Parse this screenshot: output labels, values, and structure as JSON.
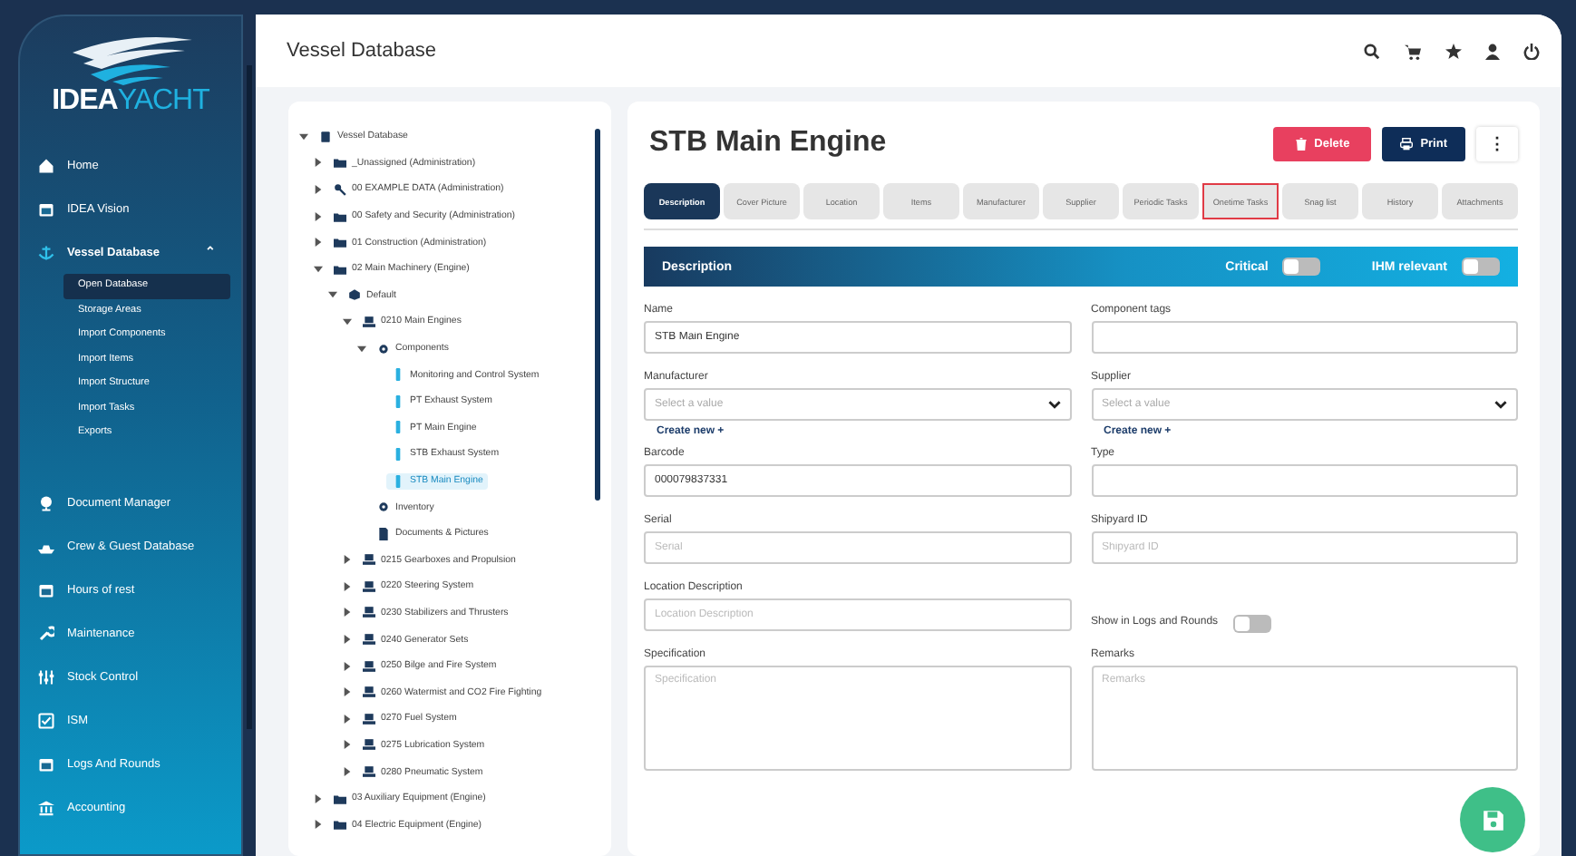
{
  "brand": {
    "part_1": "IDEA",
    "part_2": "YACHT"
  },
  "sidebar": {
    "items": [
      {
        "label": "Home",
        "kind": "home",
        "selected": false
      },
      {
        "label": "IDEA Vision",
        "kind": "calendar",
        "selected": false
      },
      {
        "label": "Vessel Database",
        "kind": "anchor",
        "selected": true,
        "expanded": true,
        "caret": "⌃",
        "children": [
          {
            "label": "Open Database",
            "selected": true
          },
          {
            "label": "Storage Areas",
            "selected": false
          },
          {
            "label": "Import Components",
            "selected": false
          },
          {
            "label": "Import Items",
            "selected": false
          },
          {
            "label": "Import Structure",
            "selected": false
          },
          {
            "label": "Import Tasks",
            "selected": false
          },
          {
            "label": "Exports",
            "selected": false
          }
        ]
      },
      {
        "label": "Document Manager",
        "kind": "globe",
        "selected": false
      },
      {
        "label": "Crew & Guest Database",
        "kind": "ship",
        "selected": false
      },
      {
        "label": "Hours of rest",
        "kind": "calendar",
        "selected": false
      },
      {
        "label": "Maintenance",
        "kind": "wrench",
        "selected": false
      },
      {
        "label": "Stock Control",
        "kind": "sliders",
        "selected": false
      },
      {
        "label": "ISM",
        "kind": "check",
        "selected": false
      },
      {
        "label": "Logs And Rounds",
        "kind": "calendar",
        "selected": false
      },
      {
        "label": "Accounting",
        "kind": "bank",
        "selected": false
      }
    ]
  },
  "topbar": {
    "title": "Vessel Database"
  },
  "tree": [
    {
      "label": "Vessel Database",
      "kind": "db",
      "expanded": true,
      "selected": false,
      "children": [
        {
          "label": "_Unassigned (Administration)",
          "kind": "folder",
          "expanded": false,
          "selected": false
        },
        {
          "label": "00 EXAMPLE DATA (Administration)",
          "kind": "key",
          "expanded": false,
          "selected": false
        },
        {
          "label": "00 Safety and Security (Administration)",
          "kind": "folder",
          "expanded": false,
          "selected": false
        },
        {
          "label": "01 Construction (Administration)",
          "kind": "folder",
          "expanded": false,
          "selected": false
        },
        {
          "label": "02 Main Machinery (Engine)",
          "kind": "folder",
          "expanded": true,
          "selected": false,
          "children": [
            {
              "label": "Default",
              "kind": "box",
              "expanded": true,
              "selected": false,
              "children": [
                {
                  "label": "0210 Main Engines",
                  "kind": "machine",
                  "expanded": true,
                  "selected": false,
                  "children": [
                    {
                      "label": "Components",
                      "kind": "cog",
                      "expanded": true,
                      "selected": false,
                      "children": [
                        {
                          "label": "Monitoring and Control System",
                          "kind": "part",
                          "selected": false
                        },
                        {
                          "label": "PT Exhaust System",
                          "kind": "part",
                          "selected": false
                        },
                        {
                          "label": "PT Main Engine",
                          "kind": "part",
                          "selected": false
                        },
                        {
                          "label": "STB Exhaust System",
                          "kind": "part",
                          "selected": false
                        },
                        {
                          "label": "STB Main Engine",
                          "kind": "part",
                          "selected": true
                        }
                      ]
                    },
                    {
                      "label": "Inventory",
                      "kind": "cog",
                      "selected": false
                    },
                    {
                      "label": "Documents & Pictures",
                      "kind": "doc",
                      "selected": false
                    }
                  ]
                },
                {
                  "label": "0215 Gearboxes and Propulsion",
                  "kind": "machine",
                  "expanded": false,
                  "selected": false
                },
                {
                  "label": "0220 Steering System",
                  "kind": "machine",
                  "expanded": false,
                  "selected": false
                },
                {
                  "label": "0230 Stabilizers and Thrusters",
                  "kind": "machine",
                  "expanded": false,
                  "selected": false
                },
                {
                  "label": "0240 Generator Sets",
                  "kind": "machine",
                  "expanded": false,
                  "selected": false
                },
                {
                  "label": "0250 Bilge and Fire System",
                  "kind": "machine",
                  "expanded": false,
                  "selected": false
                },
                {
                  "label": "0260 Watermist and CO2 Fire Fighting",
                  "kind": "machine",
                  "expanded": false,
                  "selected": false
                },
                {
                  "label": "0270 Fuel System",
                  "kind": "machine",
                  "expanded": false,
                  "selected": false
                },
                {
                  "label": "0275 Lubrication System",
                  "kind": "machine",
                  "expanded": false,
                  "selected": false
                },
                {
                  "label": "0280 Pneumatic System",
                  "kind": "machine",
                  "expanded": false,
                  "selected": false
                }
              ]
            }
          ]
        },
        {
          "label": "03 Auxiliary Equipment (Engine)",
          "kind": "folder",
          "expanded": false,
          "selected": false
        },
        {
          "label": "04 Electric Equipment (Engine)",
          "kind": "folder",
          "expanded": false,
          "selected": false
        }
      ]
    }
  ],
  "detail": {
    "title": "STB Main Engine",
    "buttons": [
      {
        "label": "Delete",
        "kind": "delete"
      },
      {
        "label": "Print",
        "kind": "print"
      },
      {
        "label": "⋮",
        "kind": "more"
      }
    ],
    "tabs": [
      {
        "label": "Description",
        "selected": true,
        "highlighted": false
      },
      {
        "label": "Cover Picture",
        "selected": false,
        "highlighted": false
      },
      {
        "label": "Location",
        "selected": false,
        "highlighted": false
      },
      {
        "label": "Items",
        "selected": false,
        "highlighted": false
      },
      {
        "label": "Manufacturer",
        "selected": false,
        "highlighted": false
      },
      {
        "label": "Supplier",
        "selected": false,
        "highlighted": false
      },
      {
        "label": "Periodic Tasks",
        "selected": false,
        "highlighted": false
      },
      {
        "label": "Onetime Tasks",
        "selected": false,
        "highlighted": true
      },
      {
        "label": "Snag list",
        "selected": false,
        "highlighted": false
      },
      {
        "label": "History",
        "selected": false,
        "highlighted": false
      },
      {
        "label": "Attachments",
        "selected": false,
        "highlighted": false
      }
    ],
    "section": {
      "title": "Description",
      "toggles": [
        {
          "label": "Critical",
          "on": false
        },
        {
          "label": "IHM relevant",
          "on": false
        }
      ]
    },
    "fields": [
      {
        "kind": "text",
        "label": "Name",
        "value": "STB Main Engine"
      },
      {
        "kind": "text",
        "label": "Component tags"
      },
      {
        "kind": "select",
        "label": "Manufacturer",
        "placeholder": "Select a value",
        "link": "Create new +"
      },
      {
        "kind": "select",
        "label": "Supplier",
        "placeholder": "Select a value",
        "link": "Create new +"
      },
      {
        "kind": "text",
        "label": "Barcode",
        "value": "000079837331"
      },
      {
        "kind": "text",
        "label": "Type"
      },
      {
        "kind": "text",
        "label": "Serial",
        "placeholder": "Serial"
      },
      {
        "kind": "text",
        "label": "Shipyard ID",
        "placeholder": "Shipyard ID"
      },
      {
        "kind": "text",
        "label": "Location Description",
        "placeholder": "Location Description"
      },
      {
        "kind": "toggle",
        "label": "Show in Logs and Rounds",
        "on": false
      },
      {
        "kind": "textarea",
        "label": "Specification",
        "placeholder": "Specification"
      },
      {
        "kind": "textarea",
        "label": "Remarks",
        "placeholder": "Remarks"
      }
    ]
  }
}
